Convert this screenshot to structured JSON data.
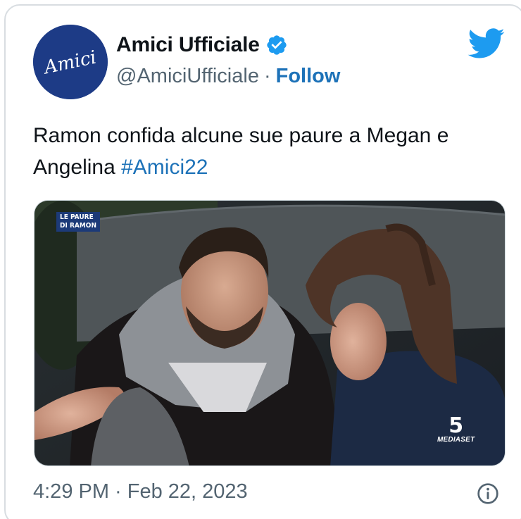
{
  "tweet": {
    "display_name": "Amici Ufficiale",
    "handle": "@AmiciUfficiale",
    "separator": "·",
    "follow_label": "Follow",
    "avatar_logo_text": "Amici",
    "verified": true,
    "text_main": "Ramon confida alcune sue paure a Megan e Angelina ",
    "hashtag": "#Amici22",
    "media": {
      "overlay_label": "LE PAURE\nDI RAMON",
      "broadcaster_mark": "5",
      "broadcaster_name": "MEDIASET"
    },
    "timestamp": "4:29 PM · Feb 22, 2023"
  },
  "icons": {
    "brand": "twitter-bird-icon",
    "verified": "verified-badge-icon",
    "info": "info-icon"
  },
  "colors": {
    "link": "#1d72b8",
    "twitter_blue": "#1d9bf0",
    "avatar_bg": "#1d3b86",
    "muted_text": "#536471",
    "border": "#d8dde1"
  }
}
